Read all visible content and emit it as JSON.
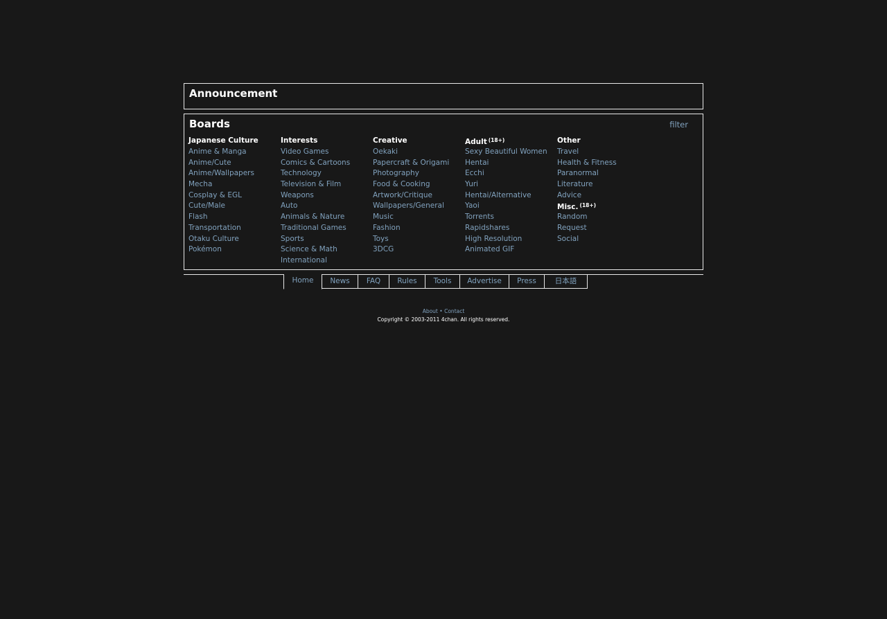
{
  "announcement": {
    "title": "Announcement"
  },
  "boards": {
    "title": "Boards",
    "filter_label": "filter",
    "columns": [
      {
        "sections": [
          {
            "header": "Japanese Culture",
            "badge": "",
            "items": [
              "Anime & Manga",
              "Anime/Cute",
              "Anime/Wallpapers",
              "Mecha",
              "Cosplay & EGL",
              "Cute/Male",
              "Flash",
              "Transportation",
              "Otaku Culture",
              "Pokémon"
            ]
          }
        ]
      },
      {
        "sections": [
          {
            "header": "Interests",
            "badge": "",
            "items": [
              "Video Games",
              "Comics & Cartoons",
              "Technology",
              "Television & Film",
              "Weapons",
              "Auto",
              "Animals & Nature",
              "Traditional Games",
              "Sports",
              "Science & Math",
              "International"
            ]
          }
        ]
      },
      {
        "sections": [
          {
            "header": "Creative",
            "badge": "",
            "items": [
              "Oekaki",
              "Papercraft & Origami",
              "Photography",
              "Food & Cooking",
              "Artwork/Critique",
              "Wallpapers/General",
              "Music",
              "Fashion",
              "Toys",
              "3DCG"
            ]
          }
        ]
      },
      {
        "sections": [
          {
            "header": "Adult",
            "badge": "(18+)",
            "items": [
              "Sexy Beautiful Women",
              "Hentai",
              "Ecchi",
              "Yuri",
              "Hentai/Alternative",
              "Yaoi",
              "Torrents",
              "Rapidshares",
              "High Resolution",
              "Animated GIF"
            ]
          }
        ]
      },
      {
        "sections": [
          {
            "header": "Other",
            "badge": "",
            "items": [
              "Travel",
              "Health & Fitness",
              "Paranormal",
              "Literature",
              "Advice"
            ]
          },
          {
            "header": "Misc.",
            "badge": "(18+)",
            "items": [
              "Random",
              "Request",
              "Social"
            ]
          }
        ]
      }
    ]
  },
  "nav": {
    "tabs": [
      {
        "label": "Home",
        "active": true
      },
      {
        "label": "News",
        "active": false
      },
      {
        "label": "FAQ",
        "active": false
      },
      {
        "label": "Rules",
        "active": false
      },
      {
        "label": "Tools",
        "active": false
      },
      {
        "label": "Advertise",
        "active": false
      },
      {
        "label": "Press",
        "active": false
      },
      {
        "label": "日本語",
        "active": false
      }
    ]
  },
  "footer": {
    "about": "About",
    "separator": "•",
    "contact": "Contact",
    "copyright": "Copyright © 2003-2011 4chan. All rights reserved."
  },
  "colors": {
    "background": "#181818",
    "link": "#81a2be",
    "border": "#e8e8e8",
    "text": "#ffffff"
  }
}
